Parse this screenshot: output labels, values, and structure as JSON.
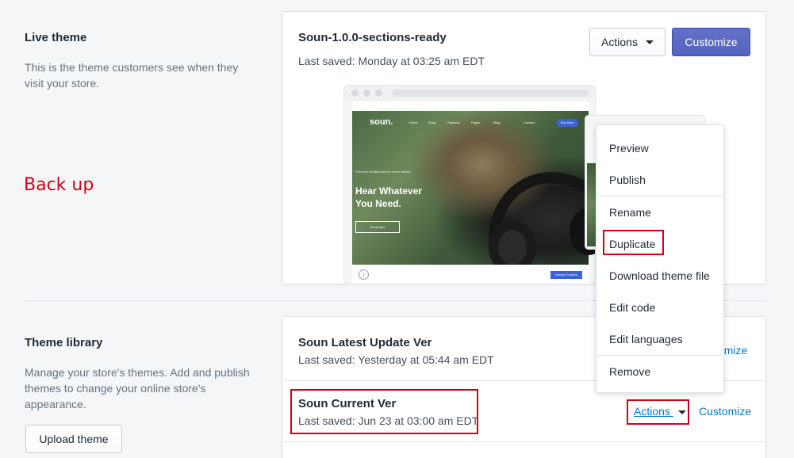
{
  "live_theme": {
    "title": "Live theme",
    "description": "This is the theme customers see when they visit your store.",
    "theme_name": "Soun-1.0.0-sections-ready",
    "last_saved": "Last saved: Monday at 03:25 am EDT",
    "actions_label": "Actions",
    "customize_label": "Customize"
  },
  "annotation": {
    "back_up": "Back up"
  },
  "preview": {
    "logo": "soun.",
    "nav": [
      "Home",
      "Shop",
      "Features",
      "Pages",
      "Blog",
      "Contact"
    ],
    "top_button": "Buy Now",
    "hero_small": "Premium headphones for every listener",
    "hero_title_line1": "Hear Whatever",
    "hero_title_line2": "You Need.",
    "shop_now": "Shop Now",
    "cookie_button": "Accept Cookies"
  },
  "actions_menu": {
    "items_group1": [
      "Preview",
      "Publish"
    ],
    "items_group2": [
      "Rename",
      "Duplicate",
      "Download theme file",
      "Edit code",
      "Edit languages"
    ],
    "items_group3": [
      "Remove"
    ]
  },
  "theme_library": {
    "title": "Theme library",
    "description": "Manage your store's themes. Add and publish themes to change your online store's appearance.",
    "upload_label": "Upload theme",
    "themes": [
      {
        "name": "Soun Latest Update Ver",
        "last_saved": "Last saved: Yesterday at 05:44 am EDT",
        "customize": "omize"
      },
      {
        "name": "Soun Current Ver",
        "last_saved": "Last saved: Jun 23 at 03:00 am EDT",
        "actions": "Actions",
        "customize": "Customize"
      }
    ]
  },
  "colors": {
    "primary": "#5c6ac4",
    "link": "#007ace",
    "highlight": "#d0021b"
  }
}
